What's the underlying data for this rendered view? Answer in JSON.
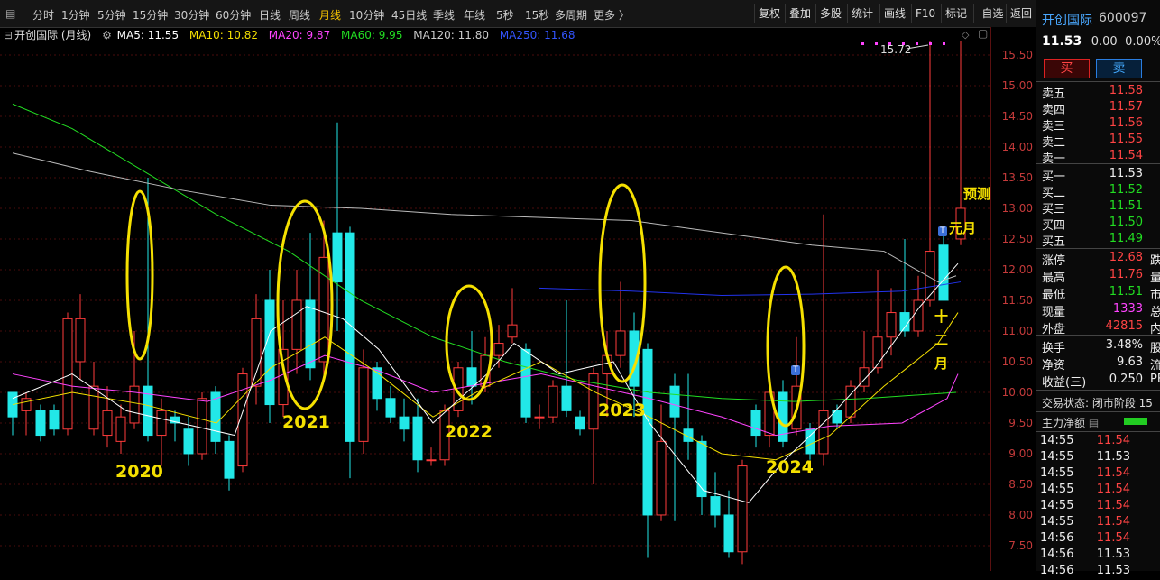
{
  "toolbar": {
    "periods": [
      "分时",
      "1分钟",
      "5分钟",
      "15分钟",
      "30分钟",
      "60分钟",
      "日线",
      "周线",
      "月线",
      "10分钟",
      "45日线",
      "季线",
      "年线",
      "5秒",
      "15秒",
      "多周期",
      "更多 〉"
    ],
    "active_period": "月线",
    "right_buttons": [
      "复权",
      "叠加",
      "多股",
      "统计",
      "画线",
      "F10",
      "标记",
      "-自选",
      "返回"
    ]
  },
  "chart": {
    "title": "开创国际 (月线)",
    "ma": [
      {
        "label": "MA5: 11.55",
        "color": "#ffffff"
      },
      {
        "label": "MA10: 10.82",
        "color": "#f5e000"
      },
      {
        "label": "MA20: 9.87",
        "color": "#ff44ff"
      },
      {
        "label": "MA60: 9.95",
        "color": "#22dd22"
      },
      {
        "label": "MA120: 11.80",
        "color": "#cccccc"
      },
      {
        "label": "MA250: 11.68",
        "color": "#3355ff"
      }
    ],
    "max_label": "15.72",
    "y_ticks": [
      "15.50",
      "15.00",
      "14.50",
      "14.00",
      "13.50",
      "13.00",
      "12.50",
      "12.00",
      "11.50",
      "11.00",
      "10.50",
      "10.00",
      "9.50",
      "9.00",
      "8.50",
      "8.00",
      "7.50"
    ],
    "annotations": {
      "y2020": "2020",
      "y2021": "2021",
      "y2022": "2022",
      "y2023": "2023",
      "y2024": "2024",
      "forecast": "预测",
      "yuanyue": "元月",
      "shieryue": "十二月"
    },
    "marker_label": "T"
  },
  "panel": {
    "name": "开创国际",
    "code": "600097",
    "price": "11.53",
    "change": "0.00",
    "change_pct": "0.00%",
    "buy_button": "买",
    "sell_button": "卖",
    "asks": [
      {
        "label": "卖五",
        "price": "11.58"
      },
      {
        "label": "卖四",
        "price": "11.57"
      },
      {
        "label": "卖三",
        "price": "11.56"
      },
      {
        "label": "卖二",
        "price": "11.55"
      },
      {
        "label": "卖一",
        "price": "11.54"
      }
    ],
    "bids": [
      {
        "label": "买一",
        "price": "11.53"
      },
      {
        "label": "买二",
        "price": "11.52"
      },
      {
        "label": "买三",
        "price": "11.51"
      },
      {
        "label": "买四",
        "price": "11.50"
      },
      {
        "label": "买五",
        "price": "11.49"
      }
    ],
    "stats": [
      {
        "label": "涨停",
        "value": "12.68",
        "extra": "跌"
      },
      {
        "label": "最高",
        "value": "11.76",
        "extra": "量"
      },
      {
        "label": "最低",
        "value": "11.51",
        "extra": "市"
      },
      {
        "label": "现量",
        "value": "1333",
        "extra": "总"
      },
      {
        "label": "外盘",
        "value": "42815",
        "extra": "内"
      }
    ],
    "stats2": [
      {
        "label": "换手",
        "value": "3.48%",
        "extra": "股"
      },
      {
        "label": "净资",
        "value": "9.63",
        "extra": "流"
      },
      {
        "label": "收益(三)",
        "value": "0.250",
        "extra": "PE"
      }
    ],
    "trade_status": "交易状态: 闭市阶段 15",
    "main_flow": "主力净额",
    "ticks": [
      {
        "time": "14:55",
        "price": "11.54"
      },
      {
        "time": "14:55",
        "price": "11.53"
      },
      {
        "time": "14:55",
        "price": "11.54"
      },
      {
        "time": "14:55",
        "price": "11.54"
      },
      {
        "time": "14:55",
        "price": "11.54"
      },
      {
        "time": "14:55",
        "price": "11.54"
      },
      {
        "time": "14:56",
        "price": "11.54"
      },
      {
        "time": "14:56",
        "price": "11.53"
      },
      {
        "time": "14:56",
        "price": "11.53"
      }
    ]
  }
}
